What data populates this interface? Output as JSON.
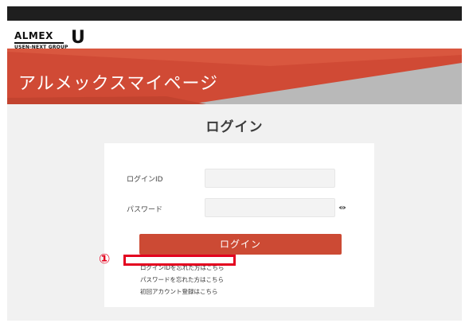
{
  "header": {
    "logo_text": "ALMEX",
    "logo_sub": "USEN-NEXT GROUP",
    "logo_mark": "U"
  },
  "banner": {
    "title": "アルメックスマイページ"
  },
  "page": {
    "title": "ログイン"
  },
  "form": {
    "id_label": "ログインID",
    "password_label": "パスワード",
    "id_value": "",
    "password_value": "",
    "submit_label": "ログイン"
  },
  "links": {
    "forgot_id": "ログインIDを忘れた方はこちら",
    "forgot_password": "パスワードを忘れた方はこちら",
    "register": "初回アカウント登録はこちら"
  },
  "annotation": {
    "marker": "①"
  },
  "colors": {
    "accent": "#cc4a34",
    "banner_dark": "#c2432f",
    "highlight": "#e3001f",
    "topbar": "#1f1f1f"
  },
  "icons": {
    "password_toggle": "eye-icon"
  }
}
